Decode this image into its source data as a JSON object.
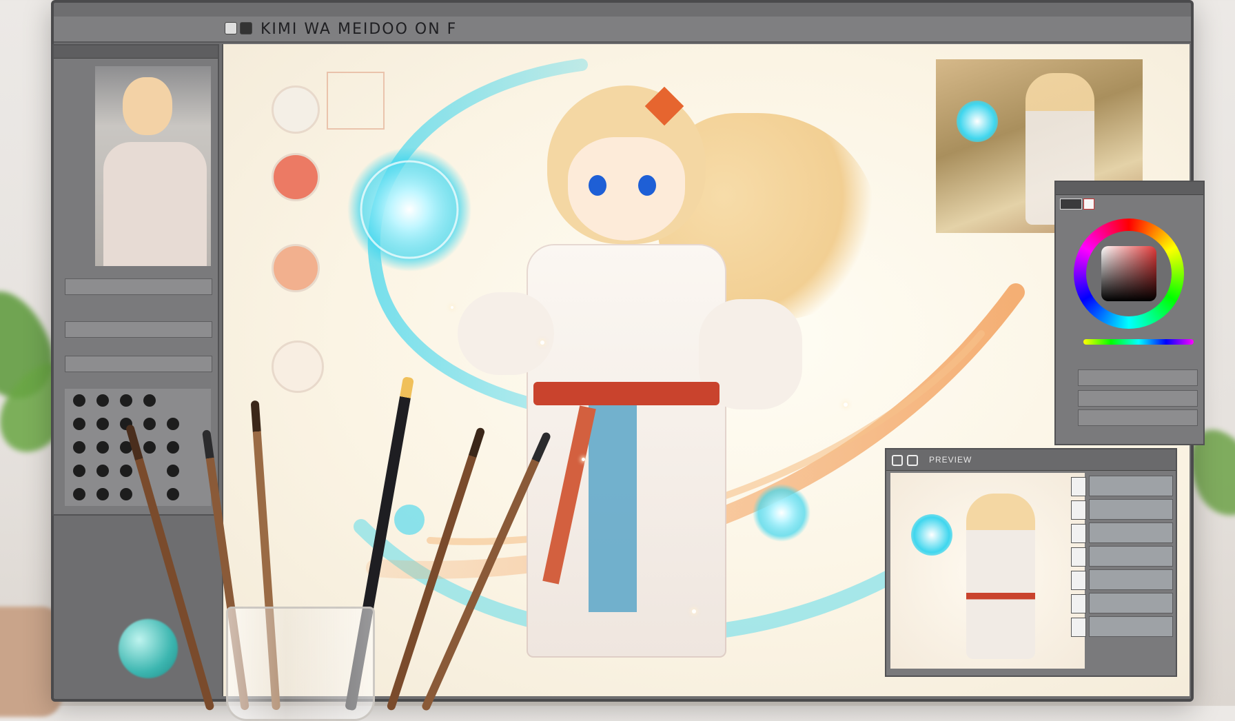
{
  "window": {
    "title": "KIMI WA MEIDOO ON F",
    "document_tab": ""
  },
  "colors": {
    "accent_cyan": "#3fd6ee",
    "accent_orange": "#f3a25f",
    "belt_red": "#c9432d",
    "sash_blue": "#5aa6c8",
    "hair_blonde": "#f2cf93"
  },
  "left_panel": {
    "preview_alt": "reference portrait thumbnail",
    "sliders": [
      "",
      "",
      ""
    ],
    "brush_grid_rows": 5,
    "brush_grid_cols": 6
  },
  "navigator": {
    "label": "reference-thumbnail"
  },
  "color_panel": {
    "wheel_icon": "color-wheel-icon",
    "sliders": [
      "",
      "",
      ""
    ]
  },
  "preview_panel": {
    "title": "PREVIEW",
    "layers": [
      "",
      "",
      "",
      "",
      "",
      "",
      ""
    ]
  },
  "canvas": {
    "subject": "anime character casting glowing orb",
    "glyph_text": ""
  },
  "icons": {
    "close": "close-icon",
    "window_controls": "window-controls-icon",
    "palette": "palette-icon",
    "brush": "brush-icon"
  }
}
